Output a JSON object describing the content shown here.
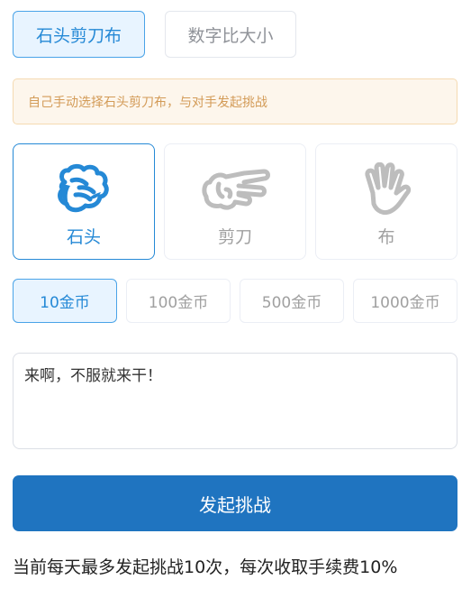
{
  "modes": {
    "rps_label": "石头剪刀布",
    "number_label": "数字比大小"
  },
  "notice": "自己手动选择石头剪刀布，与对手发起挑战",
  "choices": {
    "rock": {
      "label": "石头",
      "icon": "rock-hand-icon"
    },
    "scissors": {
      "label": "剪刀",
      "icon": "scissors-hand-icon"
    },
    "paper": {
      "label": "布",
      "icon": "paper-hand-icon"
    }
  },
  "bets": [
    "10金币",
    "100金币",
    "500金币",
    "1000金币"
  ],
  "message": {
    "value": "来啊，不服就来干！"
  },
  "submit_label": "发起挑战",
  "footnote": "当前每天最多发起挑战10次，每次收取手续费10%",
  "colors": {
    "accent": "#2589d6",
    "button": "#1f74c0",
    "notice_text": "#d39b57"
  }
}
